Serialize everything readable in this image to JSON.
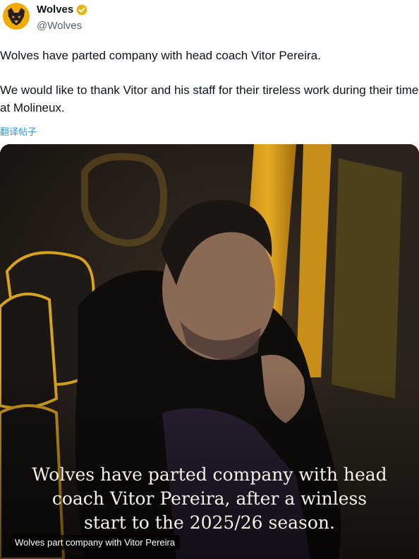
{
  "account": {
    "display_name": "Wolves",
    "handle": "@Wolves",
    "verified_badge": "gold-verified-badge-icon",
    "avatar": "wolf-crest-icon",
    "brand_color": "#f2a900"
  },
  "tweet": {
    "paragraph_1": "Wolves have parted company with head coach Vitor Pereira.",
    "paragraph_2": "We would like to thank Vitor and his staff for their tireless work during their time at Molineux.",
    "translate_label": "翻译帖子"
  },
  "media": {
    "overlay_line_1": "Wolves have parted company with head",
    "overlay_line_2": "coach Vitor Pereira, after a winless",
    "overlay_line_3": "start to the 2025/26 season.",
    "caption": "Wolves part company with Vitor Pereira"
  }
}
